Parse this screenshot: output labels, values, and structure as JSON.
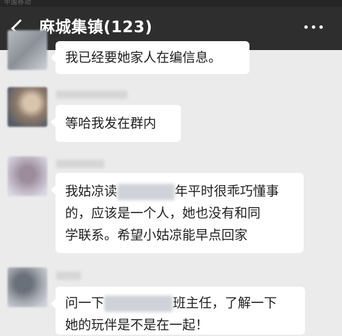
{
  "header": {
    "status_text": "中国移动",
    "title": "麻城集镇(123)"
  },
  "messages": [
    {
      "lines": [
        "我已经要她家人在编信息。"
      ]
    },
    {
      "lines": [
        "等哈我发在群内"
      ]
    },
    {
      "lines": [
        {
          "before": "我姑凉读",
          "after": "年平时很乖巧懂事"
        },
        "的，应该是一个人，她也没有和同",
        "学联系。希望小姑凉能早点回家"
      ]
    },
    {
      "lines": [
        {
          "before": "问一下",
          "after": "班主任，了解一下"
        },
        "她的玩伴是不是在一起！"
      ]
    }
  ]
}
